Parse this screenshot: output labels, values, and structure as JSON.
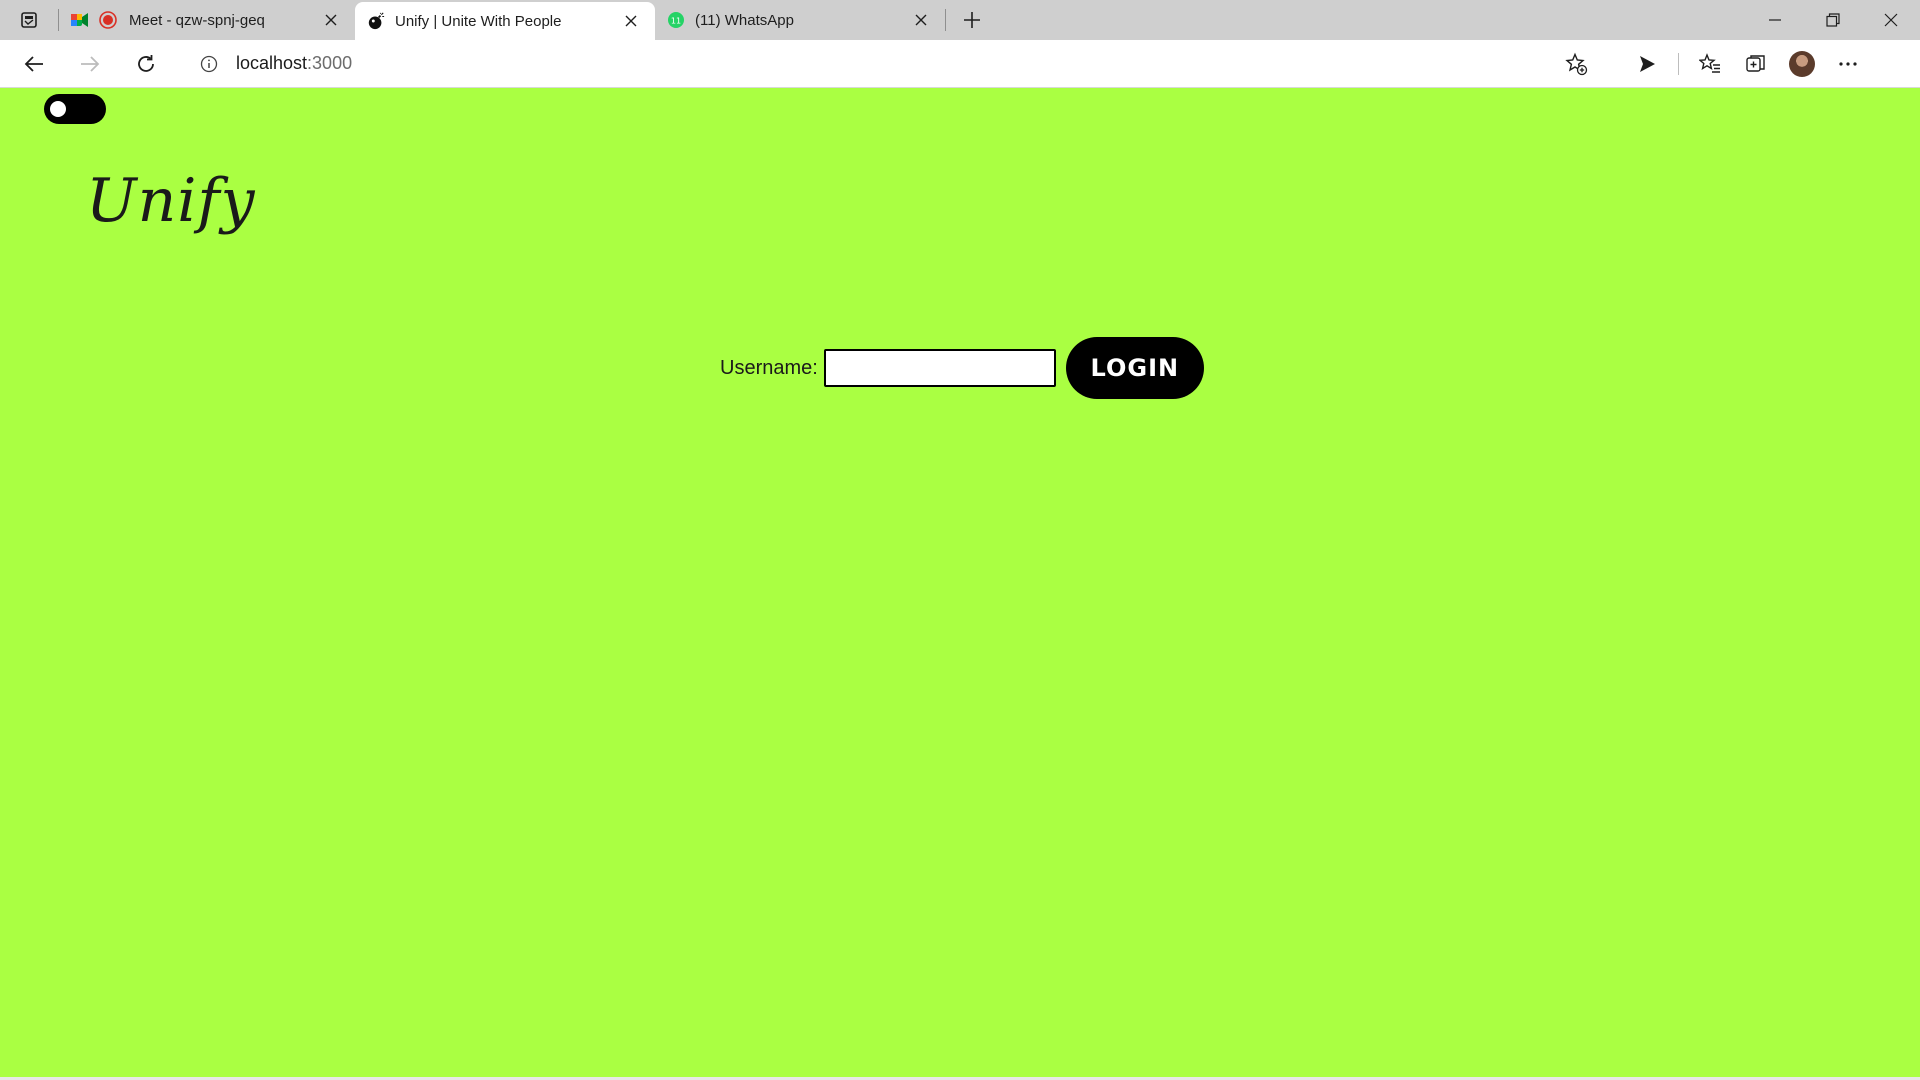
{
  "browser": {
    "tabs": [
      {
        "title": "Meet - qzw-spnj-geq",
        "favicon": "google-meet-icon",
        "recording": true
      },
      {
        "title": "Unify | Unite With People",
        "favicon": "bomb-icon",
        "active": true
      },
      {
        "title": "(11) WhatsApp",
        "favicon": "whatsapp-icon",
        "badge": "11"
      }
    ],
    "address": {
      "host": "localhost",
      "port": ":3000"
    }
  },
  "page": {
    "brand": "Unify",
    "username_label": "Username:",
    "username_value": "",
    "login_label": "LOGIN",
    "background_color": "#aaff42",
    "toggle_state": "off"
  }
}
